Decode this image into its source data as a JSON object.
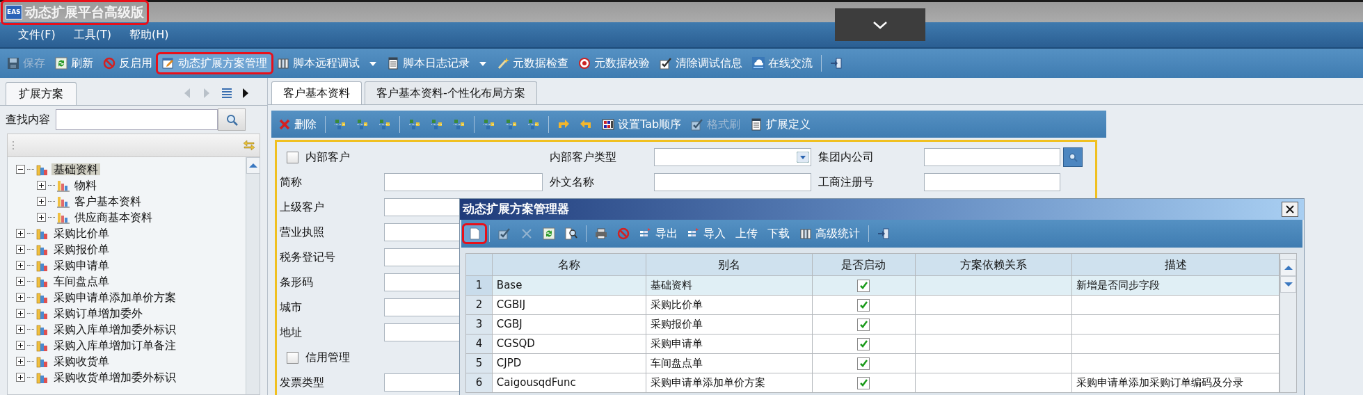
{
  "window": {
    "logo": "EAS",
    "title": "动态扩展平台高级版",
    "highlighted": true
  },
  "menu": [
    {
      "label": "文件(F)"
    },
    {
      "label": "工具(T)"
    },
    {
      "label": "帮助(H)"
    }
  ],
  "toolbar": [
    {
      "kind": "button",
      "label": "保存",
      "disabled": true,
      "dropdown": false,
      "highlighted": false
    },
    {
      "kind": "button",
      "label": "刷新",
      "disabled": false,
      "dropdown": false,
      "highlighted": false
    },
    {
      "kind": "button",
      "label": "反启用",
      "disabled": false,
      "dropdown": false,
      "highlighted": false
    },
    {
      "kind": "button",
      "label": "动态扩展方案管理",
      "disabled": false,
      "dropdown": false,
      "highlighted": true
    },
    {
      "kind": "button",
      "label": "脚本远程调试",
      "disabled": false,
      "dropdown": true,
      "highlighted": false
    },
    {
      "kind": "button",
      "label": "脚本日志记录",
      "disabled": false,
      "dropdown": true,
      "highlighted": false
    },
    {
      "kind": "button",
      "label": "元数据检查",
      "disabled": false,
      "dropdown": false,
      "highlighted": false
    },
    {
      "kind": "button",
      "label": "元数据校验",
      "disabled": false,
      "dropdown": false,
      "highlighted": false
    },
    {
      "kind": "button",
      "label": "清除调试信息",
      "disabled": false,
      "dropdown": false,
      "highlighted": false
    },
    {
      "kind": "button",
      "label": "在线交流",
      "disabled": false,
      "dropdown": false,
      "highlighted": false
    },
    {
      "kind": "separator"
    },
    {
      "kind": "icon",
      "disabled": false,
      "dropdown": false,
      "highlighted": false
    }
  ],
  "left_panel": {
    "tab": "扩展方案",
    "search_label": "查找内容",
    "tree": [
      {
        "label": "基础资料",
        "expanded": true,
        "selected": true,
        "children": [
          {
            "label": "物料",
            "expanded": false,
            "selected": false
          },
          {
            "label": "客户基本资料",
            "expanded": false,
            "selected": false
          },
          {
            "label": "供应商基本资料",
            "expanded": false,
            "selected": false
          }
        ]
      },
      {
        "label": "采购比价单",
        "expanded": false,
        "selected": false
      },
      {
        "label": "采购报价单",
        "expanded": false,
        "selected": false
      },
      {
        "label": "采购申请单",
        "expanded": false,
        "selected": false
      },
      {
        "label": "车间盘点单",
        "expanded": false,
        "selected": false
      },
      {
        "label": "采购申请单添加单价方案",
        "expanded": false,
        "selected": false
      },
      {
        "label": "采购订单增加委外",
        "expanded": false,
        "selected": false
      },
      {
        "label": "采购入库单增加委外标识",
        "expanded": false,
        "selected": false
      },
      {
        "label": "采购入库单增加订单备注",
        "expanded": false,
        "selected": false
      },
      {
        "label": "采购收货单",
        "expanded": false,
        "selected": false
      },
      {
        "label": "采购收货单增加委外标识",
        "expanded": false,
        "selected": false
      }
    ]
  },
  "content_tabs": [
    {
      "label": "客户基本资料",
      "selected": true
    },
    {
      "label": "客户基本资料-个性化布局方案",
      "selected": false
    }
  ],
  "form_toolbar": [
    {
      "kind": "button",
      "label": "删除",
      "disabled": false
    },
    {
      "kind": "separator"
    },
    {
      "kind": "icon",
      "disabled": false
    },
    {
      "kind": "icon",
      "disabled": false
    },
    {
      "kind": "icon",
      "disabled": false
    },
    {
      "kind": "separator"
    },
    {
      "kind": "icon",
      "disabled": false
    },
    {
      "kind": "icon",
      "disabled": false
    },
    {
      "kind": "icon",
      "disabled": false
    },
    {
      "kind": "separator"
    },
    {
      "kind": "icon",
      "disabled": false
    },
    {
      "kind": "icon",
      "disabled": false
    },
    {
      "kind": "icon",
      "disabled": false
    },
    {
      "kind": "separator"
    },
    {
      "kind": "icon",
      "disabled": false
    },
    {
      "kind": "icon",
      "disabled": false
    },
    {
      "kind": "button",
      "label": "设置Tab顺序",
      "disabled": false
    },
    {
      "kind": "button",
      "label": "格式刷",
      "disabled": true
    },
    {
      "kind": "button",
      "label": "扩展定义",
      "disabled": false
    }
  ],
  "form": {
    "rows": [
      [
        {
          "kind": "checkbox",
          "label": "内部客户",
          "checked": false
        },
        {
          "kind": "combo",
          "label": "内部客户类型"
        },
        {
          "kind": "lookup",
          "label": "集团内公司"
        }
      ],
      [
        {
          "kind": "text",
          "label": "简称"
        },
        {
          "kind": "text",
          "label": "外文名称"
        },
        {
          "kind": "text",
          "label": "工商注册号"
        }
      ],
      [
        {
          "kind": "text",
          "label": "上级客户"
        }
      ],
      [
        {
          "kind": "text",
          "label": "营业执照"
        }
      ],
      [
        {
          "kind": "text",
          "label": "税务登记号"
        }
      ],
      [
        {
          "kind": "text",
          "label": "条形码"
        }
      ],
      [
        {
          "kind": "text",
          "label": "城市"
        }
      ],
      [
        {
          "kind": "text",
          "label": "地址"
        }
      ],
      [
        {
          "kind": "checkbox",
          "label": "信用管理",
          "checked": false
        }
      ],
      [
        {
          "kind": "text",
          "label": "发票类型"
        }
      ]
    ]
  },
  "dialog": {
    "title": "动态扩展方案管理器",
    "toolbar": [
      {
        "kind": "icon",
        "disabled": false,
        "highlighted": true
      },
      {
        "kind": "separator"
      },
      {
        "kind": "icon",
        "disabled": true,
        "highlighted": false
      },
      {
        "kind": "icon",
        "disabled": true,
        "highlighted": false
      },
      {
        "kind": "icon",
        "disabled": false,
        "highlighted": false
      },
      {
        "kind": "icon",
        "disabled": false,
        "highlighted": false
      },
      {
        "kind": "separator"
      },
      {
        "kind": "icon",
        "disabled": false,
        "highlighted": false
      },
      {
        "kind": "icon",
        "disabled": false,
        "highlighted": false
      },
      {
        "kind": "button",
        "label": "导出",
        "disabled": false,
        "highlighted": false
      },
      {
        "kind": "button",
        "label": "导入",
        "disabled": false,
        "highlighted": false
      },
      {
        "kind": "button",
        "label": "上传",
        "disabled": false,
        "highlighted": false
      },
      {
        "kind": "button",
        "label": "下载",
        "disabled": false,
        "highlighted": false
      },
      {
        "kind": "button",
        "label": "高级统计",
        "disabled": false,
        "highlighted": false
      },
      {
        "kind": "separator"
      },
      {
        "kind": "icon",
        "disabled": false,
        "highlighted": false
      }
    ],
    "grid": {
      "columns": [
        "名称",
        "别名",
        "是否启动",
        "方案依赖关系",
        "描述"
      ],
      "rows": [
        {
          "number": "1",
          "name": "Base",
          "alias": "基础资料",
          "enabled": true,
          "description": "新增是否同步字段",
          "selected": true
        },
        {
          "number": "2",
          "name": "CGBIJ",
          "alias": "采购比价单",
          "enabled": true,
          "selected": false
        },
        {
          "number": "3",
          "name": "CGBJ",
          "alias": "采购报价单",
          "enabled": true,
          "selected": false
        },
        {
          "number": "4",
          "name": "CGSQD",
          "alias": "采购申请单",
          "enabled": true,
          "selected": false
        },
        {
          "number": "5",
          "name": "CJPD",
          "alias": "车间盘点单",
          "enabled": true,
          "selected": false
        },
        {
          "number": "6",
          "name": "CaigousqdFunc",
          "alias": "采购申请单添加单价方案",
          "enabled": true,
          "description": "采购申请单添加采购订单编码及分录",
          "selected": false
        }
      ]
    }
  }
}
